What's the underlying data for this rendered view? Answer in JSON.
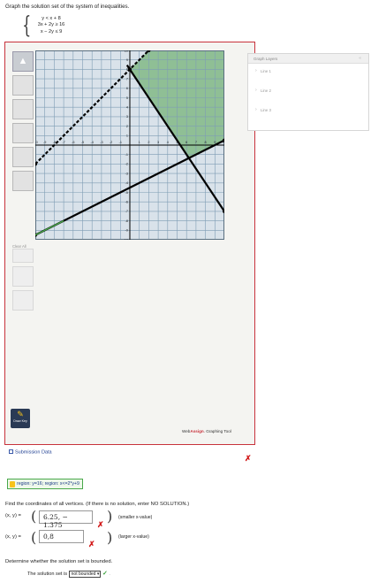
{
  "instruction": "Graph the solution set of the system of inequalities.",
  "system": [
    "y < x + 8",
    "3x + 2y ≥ 16",
    "x − 2y ≤ 9"
  ],
  "toolbar": {
    "items": [
      "pointer-tool",
      "line-tool",
      "ray-tool",
      "segment-tool",
      "point-tool",
      "fill-tool"
    ],
    "clear_label": "Clear All",
    "preview_label": "Draw Key"
  },
  "layers": {
    "title": "Graph Layers",
    "close": "«",
    "items": [
      "Line 1",
      "Line 2",
      "Line 3"
    ]
  },
  "brand": {
    "web": "Web",
    "assign": "Assign",
    "suffix": ". Graphing Tool"
  },
  "submission_label": "Submission Data",
  "region_text": "region: y=16; region: x<=2*y+9",
  "find_text": "Find the coordinates of all vertices. (If there is no solution, enter NO SOLUTION.)",
  "answers": [
    {
      "label": "(x, y) =",
      "value": "6.25, − 1.375",
      "note": "(smaller x-value)"
    },
    {
      "label": "(x, y) =",
      "value": "0,8",
      "note": "(larger x-value)"
    }
  ],
  "determine_text": "Determine whether the solution set is bounded.",
  "set_text": "The solution set is",
  "bounded_value": "not bounded",
  "chart_data": {
    "type": "line",
    "title": "",
    "xlim": [
      -10,
      10
    ],
    "ylim": [
      -10,
      10
    ],
    "grid": true,
    "x_ticks": [
      -10,
      -9,
      -8,
      -7,
      -6,
      -5,
      -4,
      -3,
      -2,
      -1,
      1,
      2,
      3,
      4,
      5,
      6,
      7,
      8,
      9,
      10
    ],
    "y_ticks": [
      10,
      9,
      8,
      7,
      6,
      5,
      4,
      3,
      2,
      1,
      -1,
      -2,
      -3,
      -4,
      -5,
      -6,
      -7,
      -8,
      -9,
      -10
    ],
    "series": [
      {
        "equation": "y = x + 8",
        "style": "dashed",
        "points": [
          [
            -10,
            -2
          ],
          [
            2,
            10
          ]
        ]
      },
      {
        "equation": "3x + 2y = 16",
        "style": "solid",
        "points": [
          [
            0,
            8
          ],
          [
            10,
            -7
          ]
        ]
      },
      {
        "equation": "x - 2y = 9",
        "style": "solid",
        "points": [
          [
            -10,
            -9.5
          ],
          [
            10,
            0.5
          ]
        ]
      }
    ],
    "shaded_region": [
      [
        0,
        8
      ],
      [
        2,
        10
      ],
      [
        10,
        10
      ],
      [
        10,
        0.5
      ],
      [
        6.25,
        -1.375
      ]
    ],
    "colors": {
      "shade": "#8fbf95",
      "grid": "#7f9db4",
      "axis": "#000000"
    }
  }
}
